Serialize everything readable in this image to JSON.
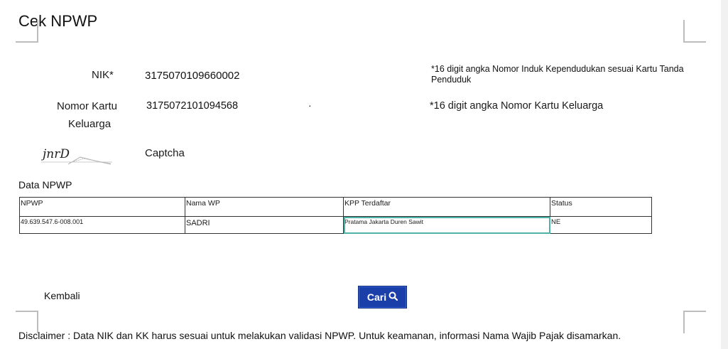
{
  "page": {
    "title": "Cek NPWP"
  },
  "form": {
    "nik_label": "NIK*",
    "nik_value": "3175070109660002",
    "nik_hint": "*16 digit angka Nomor Induk Kependudukan sesuai Kartu Tanda Penduduk",
    "kk_label_line1": "Nomor Kartu",
    "kk_label_line2": "Keluarga",
    "kk_value": "3175072101094568",
    "kk_dot": "·",
    "kk_hint": "*16 digit angka Nomor Kartu Keluarga",
    "captcha_image_text": "jnrD",
    "captcha_label": "Captcha"
  },
  "data_npwp": {
    "section_title": "Data NPWP",
    "columns": [
      "NPWP",
      "Nama WP",
      "KPP Terdaftar",
      "Status"
    ],
    "rows": [
      [
        "49.639.547.6-008.001",
        "SADRI",
        "Pratama Jakarta Duren Sawit",
        "NE"
      ]
    ]
  },
  "actions": {
    "back_label": "Kembali",
    "search_label": "Cari",
    "search_icon": "search-icon"
  },
  "footer": {
    "disclaimer": "Disclaimer : Data NIK dan KK harus sesuai untuk melakukan validasi NPWP. Untuk keamanan, informasi Nama Wajib Pajak disamarkan."
  },
  "colors": {
    "button_bg": "#1a3fa8",
    "highlight_border": "#4db3a8"
  }
}
